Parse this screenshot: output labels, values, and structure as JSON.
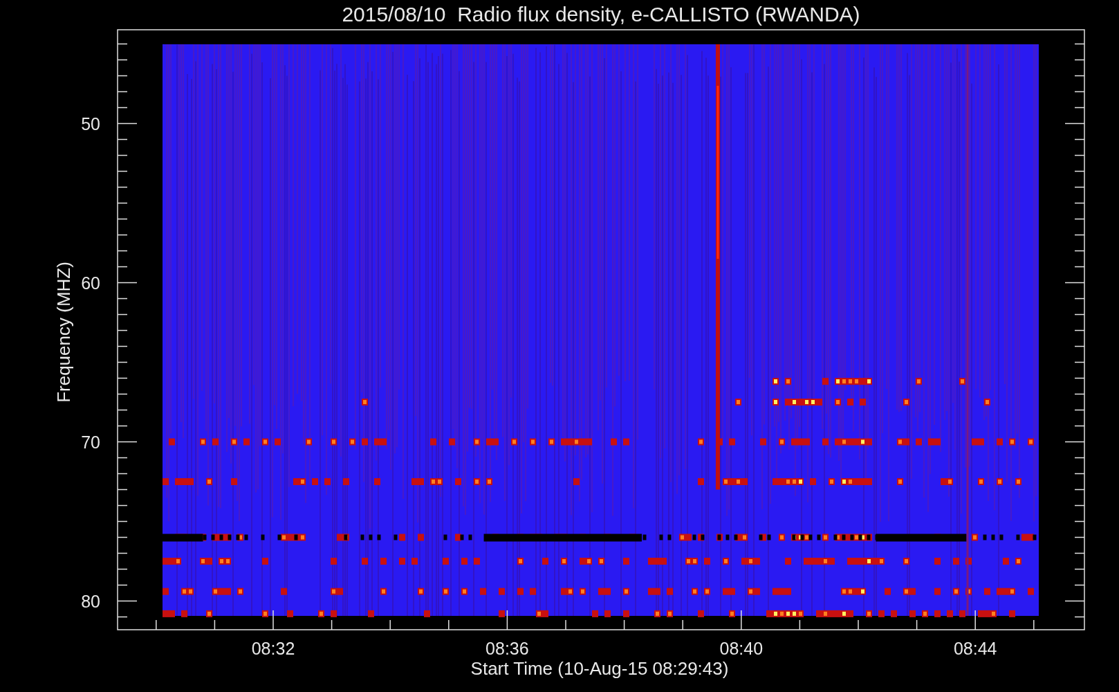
{
  "title": "2015/08/10  Radio flux density, e-CALLISTO (RWANDA)",
  "plot": {
    "ylabel": "Frequency (MHZ)",
    "xlabel": "Start Time (10-Aug-15 08:29:43)",
    "yticks": [
      "50",
      "60",
      "70",
      "80"
    ],
    "xticks": [
      "08:32",
      "08:36",
      "08:40",
      "08:44"
    ]
  }
}
